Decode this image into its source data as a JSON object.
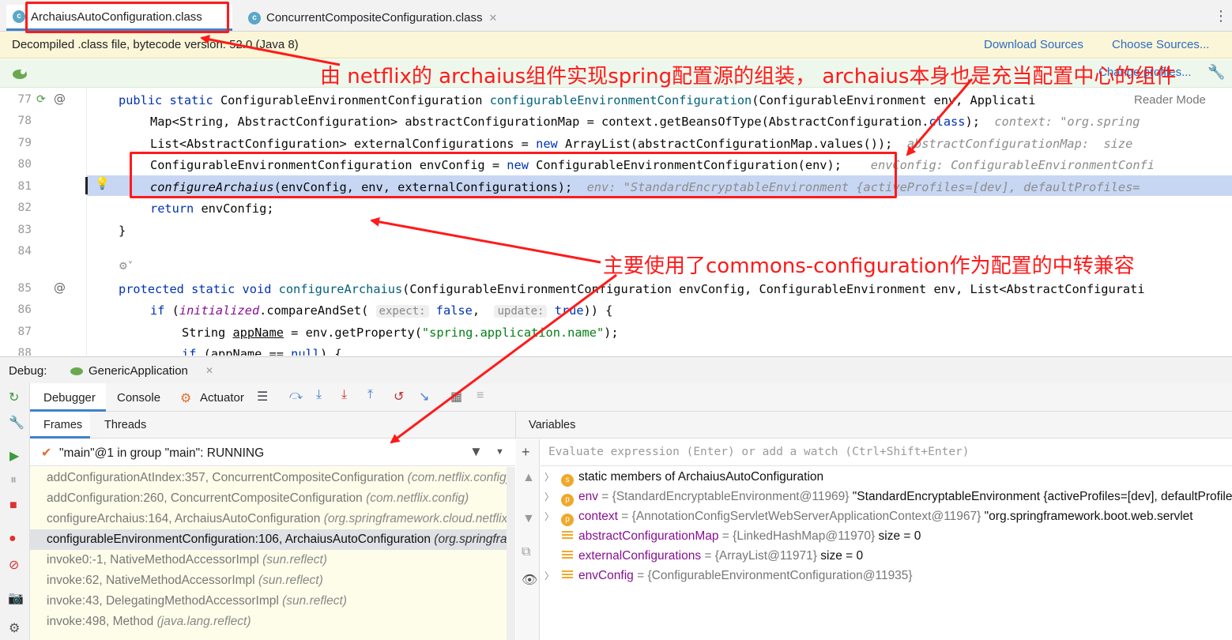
{
  "tabs": [
    {
      "label": "ArchaiusAutoConfiguration.class",
      "icon": "class-icon",
      "active": true
    },
    {
      "label": "ConcurrentCompositeConfiguration.class",
      "icon": "class-icon",
      "active": false
    }
  ],
  "decompiled_banner": {
    "text": "Decompiled .class file, bytecode version: 52.0 (Java 8)",
    "download_sources": "Download Sources",
    "choose_sources": "Choose Sources..."
  },
  "profile_bar": {
    "link": "Change profiles..."
  },
  "reader_mode": "Reader Mode",
  "annotations": {
    "top": "由 netflix的 archaius组件实现spring配置源的组装， archaius本身也是充当配置中心的组件",
    "middle": "主要使用了commons-configuration作为配置的中转兼容"
  },
  "code_lines": [
    {
      "n": "77"
    },
    {
      "n": "78"
    },
    {
      "n": "79"
    },
    {
      "n": "80"
    },
    {
      "n": "81"
    },
    {
      "n": "82"
    },
    {
      "n": "83"
    },
    {
      "n": "84"
    },
    {
      "n": "85"
    },
    {
      "n": "86"
    },
    {
      "n": "87"
    },
    {
      "n": "88"
    }
  ],
  "code": {
    "l77_a": "public static ",
    "l77_b": "ConfigurableEnvironmentConfiguration ",
    "l77_c": "configurableEnvironmentConfiguration",
    "l77_d": "(ConfigurableEnvironment env, Applicati",
    "l78_a": "Map<String, AbstractConfiguration> abstractConfigurationMap = context.getBeansOfType(AbstractConfiguration.",
    "l78_b": "class",
    "l78_c": ");",
    "l78_hint": "context: \"org.spring",
    "l79_a": "List<AbstractConfiguration> externalConfigurations = ",
    "l79_b": "new ",
    "l79_c": "ArrayList(abstractConfigurationMap.values());",
    "l79_hint": "abstractConfigurationMap:  size",
    "l80_a": "ConfigurableEnvironmentConfiguration envConfig = ",
    "l80_b": "new ",
    "l80_c": "ConfigurableEnvironmentConfiguration(env);",
    "l80_hint": "envConfig: ConfigurableEnvironmentConfi",
    "l81_a": "configureArchaius",
    "l81_b": "(envConfig, env, externalConfigurations);",
    "l81_hint": "env: \"StandardEncryptableEnvironment {activeProfiles=[dev], defaultProfiles=",
    "l82_a": "return ",
    "l82_b": "envConfig;",
    "l83": "}",
    "l85_a": "protected static void ",
    "l85_b": "configureArchaius",
    "l85_c": "(ConfigurableEnvironmentConfiguration envConfig, ConfigurableEnvironment env, List<AbstractConfigurati",
    "l86_a": "if ",
    "l86_b": "(",
    "l86_c": "initialized",
    "l86_d": ".compareAndSet(",
    "l86_h1": "expect:",
    "l86_e": " false",
    "l86_f": ",  ",
    "l86_h2": "update:",
    "l86_g": " true",
    "l86_i": ")) {",
    "l87_a": "String ",
    "l87_b": "appName",
    "l87_c": " = env.getProperty(",
    "l87_d": "\"spring.application.name\"",
    "l87_e": ");",
    "l88_a": "if ",
    "l88_b": "(appName == ",
    "l88_c": "null",
    "l88_d": ") {"
  },
  "debug": {
    "label": "Debug:",
    "session": "GenericApplication",
    "tabs": [
      "Debugger",
      "Console",
      "Actuator"
    ],
    "subtabs": [
      "Frames",
      "Threads"
    ],
    "variables_label": "Variables",
    "thread": "\"main\"@1 in group \"main\": RUNNING",
    "eval_placeholder": "Evaluate expression (Enter) or add a watch (Ctrl+Shift+Enter)"
  },
  "frames": [
    {
      "method": "addConfigurationAtIndex:357, ConcurrentCompositeConfiguration ",
      "pkg": "(com.netflix.config)"
    },
    {
      "method": "addConfiguration:260, ConcurrentCompositeConfiguration ",
      "pkg": "(com.netflix.config)"
    },
    {
      "method": "configureArchaius:164, ArchaiusAutoConfiguration ",
      "pkg": "(org.springframework.cloud.netflix.archaius)"
    },
    {
      "method": "configurableEnvironmentConfiguration:106, ArchaiusAutoConfiguration ",
      "pkg": "(org.springframework.cloud.netflix.archaius)"
    },
    {
      "method": "invoke0:-1, NativeMethodAccessorImpl ",
      "pkg": "(sun.reflect)"
    },
    {
      "method": "invoke:62, NativeMethodAccessorImpl ",
      "pkg": "(sun.reflect)"
    },
    {
      "method": "invoke:43, DelegatingMethodAccessorImpl ",
      "pkg": "(sun.reflect)"
    },
    {
      "method": "invoke:498, Method ",
      "pkg": "(java.lang.reflect)"
    }
  ],
  "variables": [
    {
      "icon": "s",
      "name": "static members of ArchaiusAutoConfiguration",
      "ref": "",
      "val": ""
    },
    {
      "icon": "p",
      "name": "env",
      "ref": " = {StandardEncryptableEnvironment@11969} ",
      "val": "\"StandardEncryptableEnvironment {activeProfiles=[dev], defaultProfiles=[default]"
    },
    {
      "icon": "p",
      "name": "context",
      "ref": " = {AnnotationConfigServletWebServerApplicationContext@11967} ",
      "val": "\"org.springframework.boot.web.servlet"
    },
    {
      "icon": "list",
      "name": "abstractConfigurationMap",
      "ref": " = {LinkedHashMap@11970} ",
      "val": " size = 0"
    },
    {
      "icon": "list",
      "name": "externalConfigurations",
      "ref": " = {ArrayList@11971} ",
      "val": " size = 0"
    },
    {
      "icon": "list",
      "name": "envConfig",
      "ref": " = {ConfigurableEnvironmentConfiguration@11935}",
      "val": ""
    }
  ],
  "colors": {
    "annotation": "#ff1a1a",
    "accent": "#4083c9",
    "selected_line": "#c7d6f3"
  }
}
